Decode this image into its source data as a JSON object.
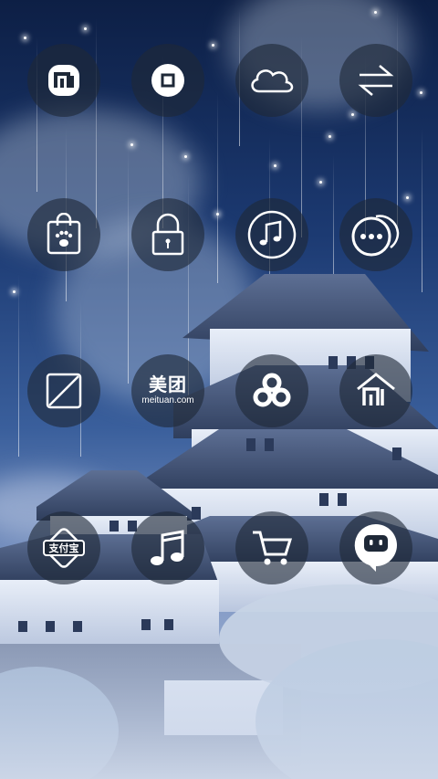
{
  "wallpaper": {
    "scene": "castle-night-sky"
  },
  "icons": [
    {
      "name": "mi-store-icon"
    },
    {
      "name": "stop-button-icon"
    },
    {
      "name": "cloud-icon"
    },
    {
      "name": "transfer-arrows-icon"
    },
    {
      "name": "shopping-bag-paw-icon"
    },
    {
      "name": "lock-icon"
    },
    {
      "name": "music-note-icon"
    },
    {
      "name": "chat-bubbles-icon"
    },
    {
      "name": "square-slash-icon"
    },
    {
      "name": "meituan-icon",
      "zh": "美团",
      "en": "meituan.com"
    },
    {
      "name": "infinity-chain-icon"
    },
    {
      "name": "mi-home-icon"
    },
    {
      "name": "alipay-icon",
      "text": "支付宝"
    },
    {
      "name": "music-note-2-icon"
    },
    {
      "name": "shopping-cart-icon"
    },
    {
      "name": "speech-bubble-icon"
    }
  ],
  "colors": {
    "icon_bg": "#1e2837",
    "icon_fg": "#ffffff"
  }
}
